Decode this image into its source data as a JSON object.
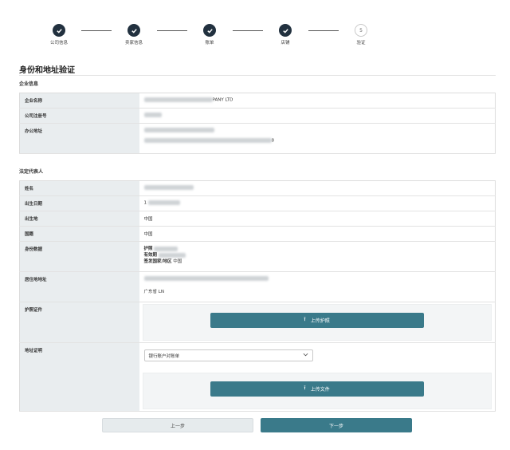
{
  "stepper": {
    "steps": [
      {
        "label": "公司信息"
      },
      {
        "label": "卖家信息"
      },
      {
        "label": "账单"
      },
      {
        "label": "店铺"
      },
      {
        "label": "验证",
        "number": "5"
      }
    ]
  },
  "page_title": "身份和地址验证",
  "company_section": {
    "title": "企业信息",
    "rows": [
      {
        "key": "企业名称",
        "value_suffix": "PANY LTD"
      },
      {
        "key": "公司注册号"
      },
      {
        "key": "办公地址",
        "value_tail": "8"
      }
    ]
  },
  "legal_section": {
    "title": "法定代表人",
    "name_label": "姓名",
    "dob_label": "出生日期",
    "dob_prefix": "1",
    "birthplace_label": "出生地",
    "birthplace_value": "中国",
    "nationality_label": "国籍",
    "nationality_value": "中国",
    "id_label": "身份数据",
    "id_line1": "护照",
    "id_line2": "有效期",
    "id_line3_label": "签发国家/地区",
    "id_line3_value": "中国",
    "residence_label": "居住地地址",
    "residence_line2": "广东省 LN",
    "passport_label": "护照证件",
    "upload_passport": "上传护照",
    "address_proof_label": "地址证明",
    "select_value": "银行账户对账单",
    "upload_file": "上传文件"
  },
  "nav": {
    "prev": "上一步",
    "next": "下一步"
  },
  "colors": {
    "accent": "#3a7a8a",
    "step_done": "#22313f",
    "key_bg": "#e9edef"
  }
}
